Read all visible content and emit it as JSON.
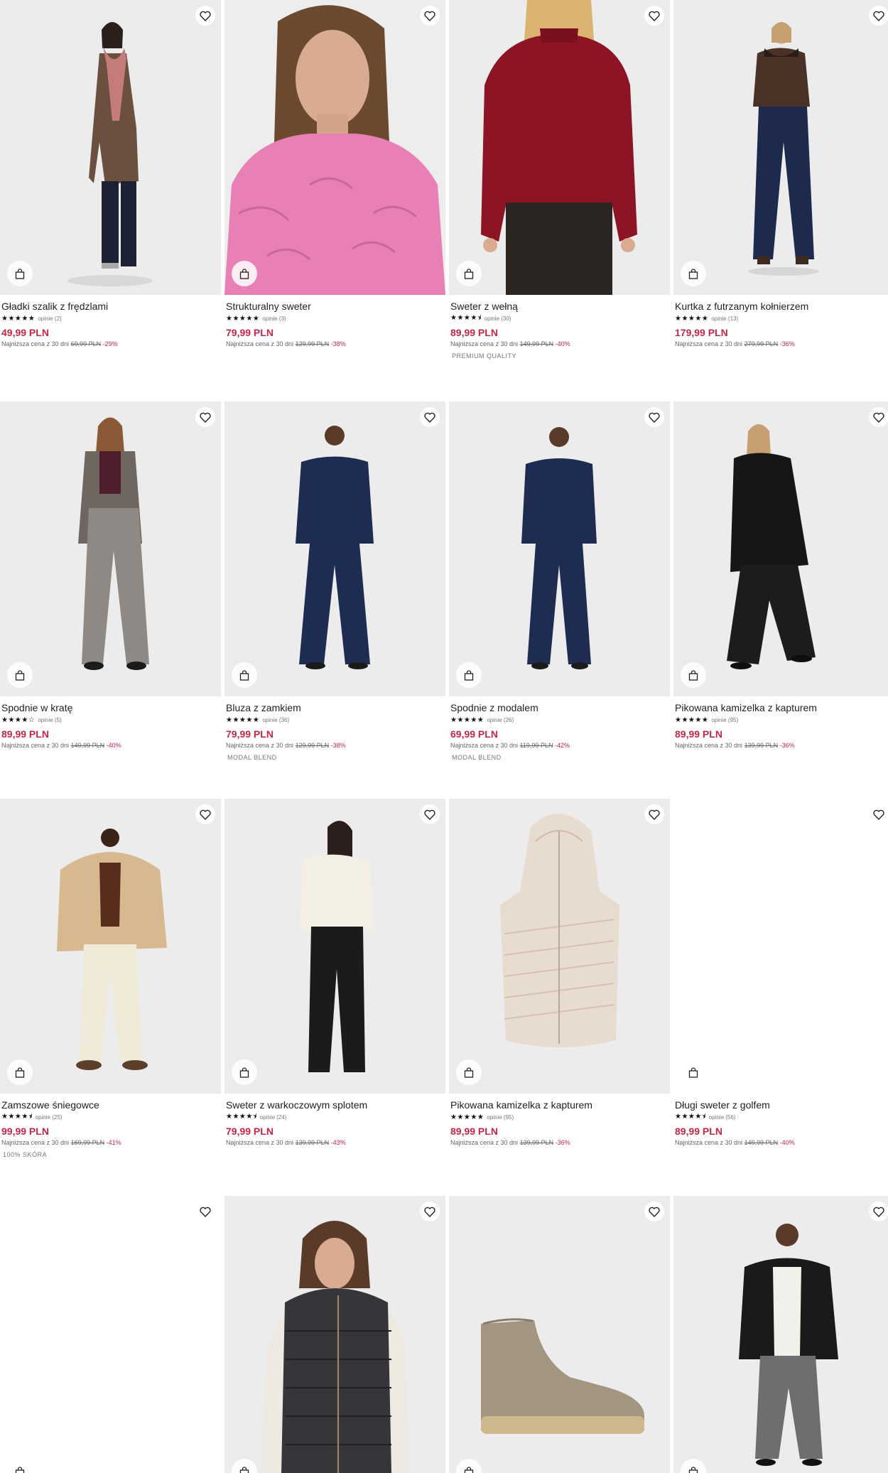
{
  "colors": {
    "price": "#c2274a",
    "discount": "#c2274a",
    "text": "#222222",
    "muted": "#666666",
    "image_bg": "#efeff0"
  },
  "icons": {
    "wishlist": "heart-icon",
    "cart": "shopping-bag-icon",
    "star": "star-icon"
  },
  "labels": {
    "reviews_prefix": "opinie",
    "lowest_prefix": "Najniższa cena z 30 dni"
  },
  "products": [
    {
      "title": "Gładki szalik z frędzlami",
      "rating": "★★★★★",
      "reviews": "opinie (2)",
      "price": "49,99 PLN",
      "lowest_label": "Najniższa cena z 30 dni",
      "old_price": "69,99 PLN",
      "discount": "-29%",
      "tag": ""
    },
    {
      "title": "Strukturalny sweter",
      "rating": "★★★★★",
      "reviews": "opinie (3)",
      "price": "79,99 PLN",
      "lowest_label": "Najniższa cena z 30 dni",
      "old_price": "129,99 PLN",
      "discount": "-38%",
      "tag": ""
    },
    {
      "title": "Sweter z wełną",
      "rating": "★★★★⯨",
      "reviews": "opinie (30)",
      "price": "89,99 PLN",
      "lowest_label": "Najniższa cena z 30 dni",
      "old_price": "149,99 PLN",
      "discount": "-40%",
      "tag": "PREMIUM QUALITY"
    },
    {
      "title": "Kurtka z futrzanym kołnierzem",
      "rating": "★★★★★",
      "reviews": "opinie (13)",
      "price": "179,99 PLN",
      "lowest_label": "Najniższa cena z 30 dni",
      "old_price": "279,99 PLN",
      "discount": "-36%",
      "tag": ""
    },
    {
      "title": "Spodnie w kratę",
      "rating": "★★★★☆",
      "reviews": "opinie (5)",
      "price": "89,99 PLN",
      "lowest_label": "Najniższa cena z 30 dni",
      "old_price": "149,99 PLN",
      "discount": "-40%",
      "tag": ""
    },
    {
      "title": "Bluza z zamkiem",
      "rating": "★★★★★",
      "reviews": "opinie (36)",
      "price": "79,99 PLN",
      "lowest_label": "Najniższa cena z 30 dni",
      "old_price": "129,99 PLN",
      "discount": "-38%",
      "tag": "MODAL BLEND"
    },
    {
      "title": "Spodnie z modalem",
      "rating": "★★★★★",
      "reviews": "opinie (26)",
      "price": "69,99 PLN",
      "lowest_label": "Najniższa cena z 30 dni",
      "old_price": "119,99 PLN",
      "discount": "-42%",
      "tag": "MODAL BLEND"
    },
    {
      "title": "Pikowana kamizelka z kapturem",
      "rating": "★★★★★",
      "reviews": "opinie (95)",
      "price": "89,99 PLN",
      "lowest_label": "Najniższa cena z 30 dni",
      "old_price": "139,99 PLN",
      "discount": "-36%",
      "tag": ""
    },
    {
      "title": "Zamszowe śniegowce",
      "rating": "★★★★⯨",
      "reviews": "opinie (25)",
      "price": "99,99 PLN",
      "lowest_label": "Najniższa cena z 30 dni",
      "old_price": "169,99 PLN",
      "discount": "-41%",
      "tag": "100% SKÓRA"
    },
    {
      "title": "Sweter z warkoczowym splotem",
      "rating": "★★★★⯨",
      "reviews": "opinie (24)",
      "price": "79,99 PLN",
      "lowest_label": "Najniższa cena z 30 dni",
      "old_price": "139,99 PLN",
      "discount": "-43%",
      "tag": ""
    },
    {
      "title": "Pikowana kamizelka z kapturem",
      "rating": "★★★★★",
      "reviews": "opinie (95)",
      "price": "89,99 PLN",
      "lowest_label": "Najniższa cena z 30 dni",
      "old_price": "139,99 PLN",
      "discount": "-36%",
      "tag": ""
    },
    {
      "title": "Długi sweter z golfem",
      "rating": "★★★★⯨",
      "reviews": "opinie (56)",
      "price": "89,99 PLN",
      "lowest_label": "Najniższa cena z 30 dni",
      "old_price": "149,99 PLN",
      "discount": "-40%",
      "tag": ""
    }
  ]
}
